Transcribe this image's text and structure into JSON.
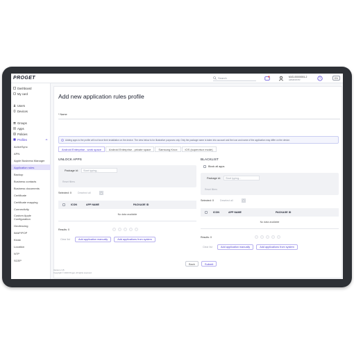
{
  "app": {
    "logo": "PROGET"
  },
  "topbar": {
    "search_placeholder": "Search",
    "user_name": "MJG-00000001-2",
    "user_role": "ADMINISTR",
    "language": "EN"
  },
  "sidebar": {
    "items": [
      {
        "label": "Dashboard",
        "icon": "dashboard-icon"
      },
      {
        "label": "My card",
        "icon": "card-icon"
      },
      {
        "label": "Users",
        "icon": "users-icon"
      },
      {
        "label": "Devices",
        "icon": "devices-icon"
      },
      {
        "label": "Groups",
        "icon": "groups-icon"
      },
      {
        "label": "Apps",
        "icon": "apps-icon"
      },
      {
        "label": "Policies",
        "icon": "policies-icon"
      },
      {
        "label": "Profiles",
        "icon": "profiles-icon"
      }
    ],
    "profile_items": [
      "ActiveSync",
      "APN",
      "Apple Business Manager",
      "Application rules",
      "Backup",
      "Business contacts",
      "Business documents",
      "Certificate",
      "Certificate mapping",
      "Connectivity",
      "Custom Apple Configuration",
      "Geofencing",
      "IMAP/POP",
      "Kiosk",
      "Location",
      "NTP",
      "SCEP"
    ],
    "active_item": "Application rules"
  },
  "main": {
    "title": "Add new application rules profile",
    "name_label": "* Name",
    "info": "Adding apps to the profile will not force their installation on the device. The view below is for illustrative purposes only. Only the package name is taken into account and the icon and name of the application may differ on the device.",
    "tabs": [
      "Android Enterprise - work space",
      "Android Enterprise - private space",
      "Samsung Knox",
      "iOS (supervisor mode)"
    ],
    "active_tab": "Android Enterprise - work space"
  },
  "unlock": {
    "title": "UNLOCK APPS",
    "filter_label": "Package id:",
    "filter_placeholder": "Start typing...",
    "reset": "Reset filters",
    "selected": "Selected: 0",
    "deselect": "Deselect all",
    "columns": [
      "ICON",
      "APP NAME",
      "PACKAGE ID"
    ],
    "no_data": "No data available",
    "results": "Results: 0",
    "clear_list": "Clear list",
    "add_manually": "Add application manually",
    "add_from_system": "Add applications from system"
  },
  "blacklist": {
    "title": "BLACKLIST",
    "block_all": "Block all apps",
    "filter_label": "Package id:",
    "filter_placeholder": "Start typing...",
    "reset": "Reset filters",
    "selected": "Selected: 0",
    "deselect": "Deselect all",
    "columns": [
      "ICON",
      "APP NAME",
      "PACKAGE ID"
    ],
    "no_data": "No data available",
    "results": "Results: 0",
    "clear_list": "Clear list",
    "add_manually": "Add application manually",
    "add_from_system": "Add applications from system"
  },
  "footer": {
    "back": "Back",
    "submit": "Submit",
    "version": "Version 2.15",
    "copyright": "Copyright © 2023 Proget. All rights reserved."
  },
  "colors": {
    "accent": "#4a3ad0",
    "active_bg": "#e4e1fa"
  }
}
